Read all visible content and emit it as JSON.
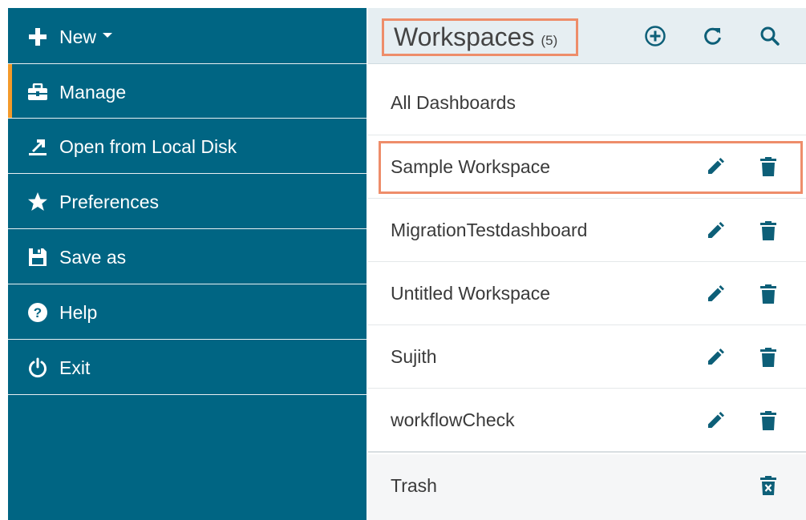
{
  "menu": {
    "items": [
      {
        "label": "New",
        "icon": "plus-icon"
      },
      {
        "label": "Manage",
        "icon": "briefcase-icon"
      },
      {
        "label": "Open from Local Disk",
        "icon": "upload-icon"
      },
      {
        "label": "Preferences",
        "icon": "star-icon"
      },
      {
        "label": "Save as",
        "icon": "floppy-disk-icon"
      },
      {
        "label": "Help",
        "icon": "help-circle-icon"
      },
      {
        "label": "Exit",
        "icon": "power-icon"
      }
    ],
    "active_item": "Manage"
  },
  "workspaces": {
    "title": "Workspaces",
    "count": "(5)",
    "header_icons": [
      "add-circle-icon",
      "refresh-icon",
      "search-icon"
    ],
    "all_dashboards": "All Dashboards",
    "rows": [
      {
        "label": "Sample Workspace",
        "selected": true
      },
      {
        "label": "MigrationTestdashboard"
      },
      {
        "label": "Untitled Workspace"
      },
      {
        "label": "Sujith"
      },
      {
        "label": "workflowCheck"
      }
    ],
    "trash": "Trash"
  },
  "colors": {
    "menu_bg": "#006583",
    "accent": "#f49a2a",
    "highlight": "#ee8d6a",
    "icon": "#0d5f78",
    "header_bg": "#e6eef2"
  }
}
